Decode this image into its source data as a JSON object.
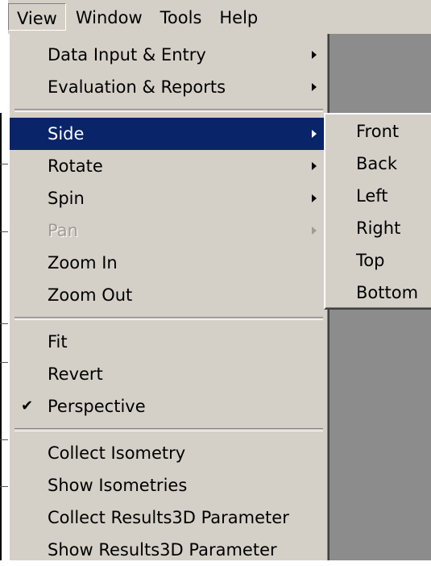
{
  "menubar": {
    "items": [
      {
        "label": "View"
      },
      {
        "label": "Window"
      },
      {
        "label": "Tools"
      },
      {
        "label": "Help"
      }
    ]
  },
  "view_menu": {
    "items": [
      {
        "label": "Data Input & Entry"
      },
      {
        "label": "Evaluation & Reports"
      },
      {
        "label": "Side"
      },
      {
        "label": "Rotate"
      },
      {
        "label": "Spin"
      },
      {
        "label": "Pan"
      },
      {
        "label": "Zoom In"
      },
      {
        "label": "Zoom Out"
      },
      {
        "label": "Fit"
      },
      {
        "label": "Revert"
      },
      {
        "label": "Perspective",
        "checkmark": "✔"
      },
      {
        "label": "Collect Isometry"
      },
      {
        "label": "Show Isometries"
      },
      {
        "label": "Collect Results3D Parameter"
      },
      {
        "label": "Show Results3D Parameter"
      }
    ]
  },
  "side_submenu": {
    "items": [
      {
        "label": "Front"
      },
      {
        "label": "Back"
      },
      {
        "label": "Left"
      },
      {
        "label": "Right"
      },
      {
        "label": "Top"
      },
      {
        "label": "Bottom"
      }
    ]
  },
  "colors": {
    "menu_bg": "#d4d0c8",
    "highlight": "#0a246a",
    "disabled_text": "#a09c94",
    "workspace": "#8c8c8c"
  }
}
